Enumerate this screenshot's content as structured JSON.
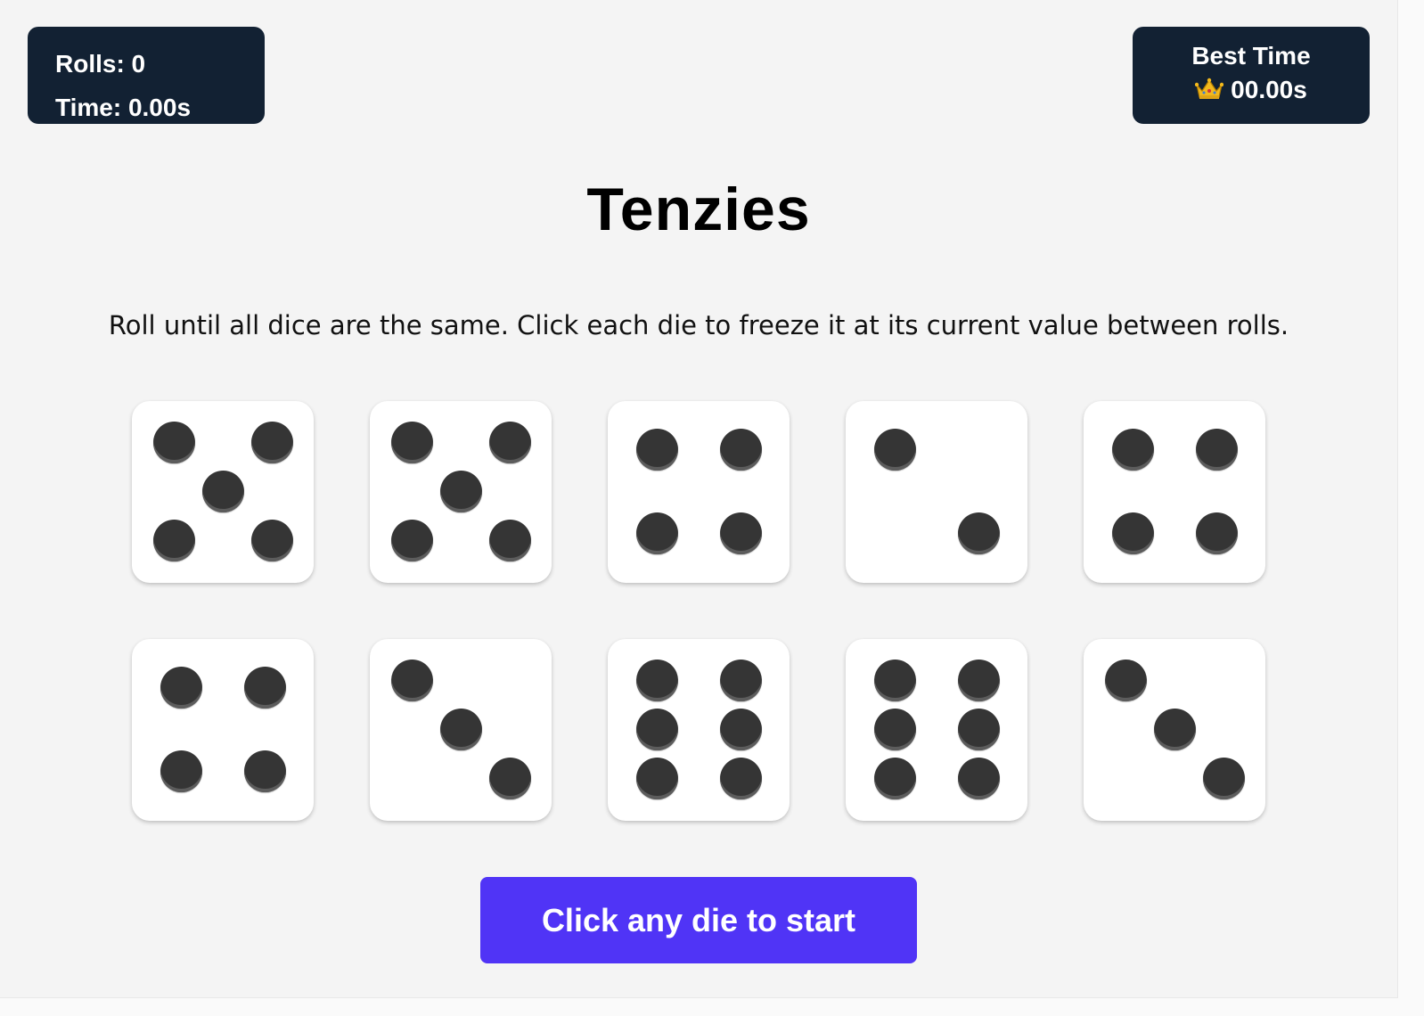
{
  "stats": {
    "rolls_text": "Rolls: 0",
    "time_text": "Time: 0.00s"
  },
  "best_time": {
    "title": "Best Time",
    "value": "00.00s",
    "icon": "crown-icon"
  },
  "header": {
    "title": "Tenzies"
  },
  "instructions": "Roll until all dice are the same. Click each die to freeze it at its current value between rolls.",
  "dice": [
    {
      "value": 5,
      "held": false
    },
    {
      "value": 5,
      "held": false
    },
    {
      "value": 4,
      "held": false
    },
    {
      "value": 2,
      "held": false
    },
    {
      "value": 4,
      "held": false
    },
    {
      "value": 4,
      "held": false
    },
    {
      "value": 3,
      "held": false
    },
    {
      "value": 6,
      "held": false
    },
    {
      "value": 6,
      "held": false
    },
    {
      "value": 3,
      "held": false
    }
  ],
  "roll_button": {
    "label": "Click any die to start"
  },
  "colors": {
    "panel_bg": "#122133",
    "button_bg": "#5034f6",
    "die_face": "#ffffff",
    "pip": "#353535",
    "background": "#f4f4f4"
  }
}
